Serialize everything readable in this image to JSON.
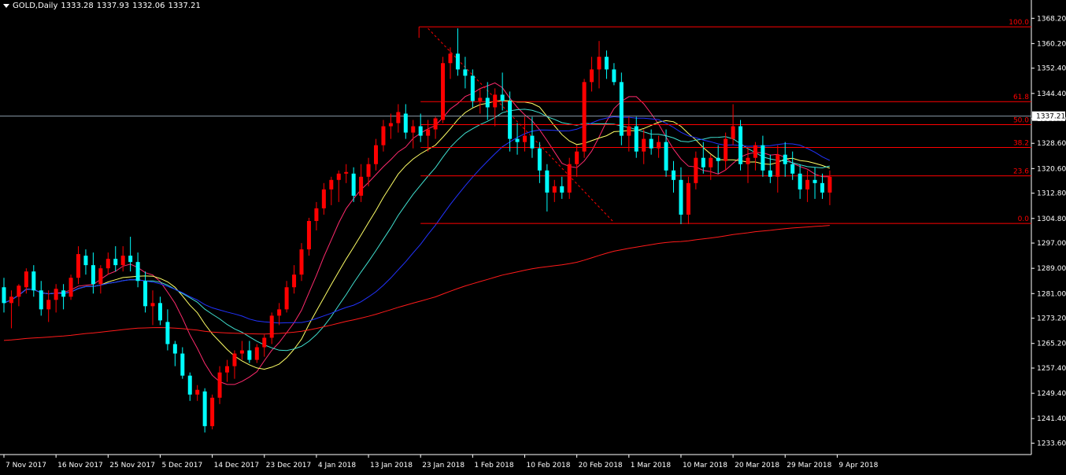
{
  "header": {
    "symbol": "GOLD,Daily",
    "open": "1333.28",
    "high": "1337.93",
    "low": "1332.06",
    "close": "1337.21"
  },
  "current_price_label": "1337.21",
  "colors": {
    "background": "#000000",
    "bull": "#ff0000",
    "bear": "#00ffff",
    "fib": "#ff0000",
    "ma_fast": "#ff2a6d",
    "ma_yellow": "#ffff66",
    "ma_cyan": "#40e0d0",
    "ma_blue": "#2233ff",
    "ma_200": "#ff1a1a",
    "current_price_line": "#8a9aa8"
  },
  "chart_data": {
    "type": "candlestick",
    "title": "GOLD,Daily",
    "ylim": [
      1230.0,
      1374.0
    ],
    "y_ticks": [
      "1368.20",
      "1360.20",
      "1352.40",
      "1344.40",
      "1336.40",
      "1328.60",
      "1320.60",
      "1312.80",
      "1304.80",
      "1297.00",
      "1289.00",
      "1281.00",
      "1273.20",
      "1265.20",
      "1257.40",
      "1249.40",
      "1241.40",
      "1233.60"
    ],
    "x_labels": [
      {
        "i": 0,
        "text": "7 Nov 2017"
      },
      {
        "i": 7,
        "text": "16 Nov 2017"
      },
      {
        "i": 14,
        "text": "25 Nov 2017"
      },
      {
        "i": 21,
        "text": "5 Dec 2017"
      },
      {
        "i": 28,
        "text": "14 Dec 2017"
      },
      {
        "i": 35,
        "text": "23 Dec 2017"
      },
      {
        "i": 42,
        "text": "4 Jan 2018"
      },
      {
        "i": 49,
        "text": "13 Jan 2018"
      },
      {
        "i": 56,
        "text": "23 Jan 2018"
      },
      {
        "i": 63,
        "text": "1 Feb 2018"
      },
      {
        "i": 70,
        "text": "10 Feb 2018"
      },
      {
        "i": 77,
        "text": "20 Feb 2018"
      },
      {
        "i": 84,
        "text": "1 Mar 2018"
      },
      {
        "i": 91,
        "text": "10 Mar 2018"
      },
      {
        "i": 98,
        "text": "20 Mar 2018"
      },
      {
        "i": 105,
        "text": "29 Mar 2018"
      },
      {
        "i": 112,
        "text": "9 Apr 2018"
      }
    ],
    "candles": [
      [
        1283.0,
        1286.0,
        1275.0,
        1278.0
      ],
      [
        1278.0,
        1282.0,
        1270.0,
        1280.0
      ],
      [
        1280.0,
        1284.0,
        1277.0,
        1283.5
      ],
      [
        1283.0,
        1289.0,
        1281.0,
        1288.0
      ],
      [
        1288.0,
        1290.0,
        1280.0,
        1282.0
      ],
      [
        1282.0,
        1285.0,
        1274.0,
        1276.0
      ],
      [
        1276.0,
        1282.0,
        1272.0,
        1279.0
      ],
      [
        1279.0,
        1284.0,
        1275.0,
        1282.5
      ],
      [
        1282.0,
        1284.0,
        1276.0,
        1280.0
      ],
      [
        1280.0,
        1287.0,
        1279.0,
        1286.0
      ],
      [
        1286.0,
        1296.0,
        1284.0,
        1293.5
      ],
      [
        1293.0,
        1295.0,
        1287.0,
        1290.0
      ],
      [
        1290.0,
        1294.0,
        1281.0,
        1284.0
      ],
      [
        1284.0,
        1290.0,
        1281.0,
        1289.0
      ],
      [
        1289.0,
        1294.0,
        1287.0,
        1292.0
      ],
      [
        1292.0,
        1296.0,
        1288.0,
        1290.0
      ],
      [
        1290.0,
        1296.0,
        1288.0,
        1293.0
      ],
      [
        1293.0,
        1299.0,
        1288.0,
        1291.0
      ],
      [
        1291.0,
        1294.0,
        1283.0,
        1285.0
      ],
      [
        1285.0,
        1288.0,
        1275.0,
        1277.0
      ],
      [
        1277.0,
        1282.0,
        1271.0,
        1278.0
      ],
      [
        1278.0,
        1280.0,
        1271.0,
        1272.5
      ],
      [
        1272.0,
        1276.0,
        1263.0,
        1265.0
      ],
      [
        1265.0,
        1266.0,
        1258.0,
        1262.0
      ],
      [
        1262.0,
        1264.0,
        1254.0,
        1255.0
      ],
      [
        1255.0,
        1256.0,
        1247.0,
        1249.0
      ],
      [
        1249.0,
        1252.0,
        1247.0,
        1250.5
      ],
      [
        1250.0,
        1251.0,
        1237.0,
        1239.0
      ],
      [
        1239.0,
        1249.0,
        1238.0,
        1248.0
      ],
      [
        1248.0,
        1258.0,
        1246.0,
        1256.0
      ],
      [
        1256.0,
        1260.0,
        1253.0,
        1258.0
      ],
      [
        1258.0,
        1263.0,
        1254.0,
        1262.0
      ],
      [
        1262.0,
        1266.0,
        1260.0,
        1263.0
      ],
      [
        1263.0,
        1266.0,
        1259.0,
        1260.0
      ],
      [
        1260.0,
        1265.0,
        1259.0,
        1264.0
      ],
      [
        1264.0,
        1268.0,
        1261.0,
        1267.0
      ],
      [
        1267.0,
        1275.0,
        1265.0,
        1274.0
      ],
      [
        1274.0,
        1278.0,
        1271.0,
        1276.0
      ],
      [
        1276.0,
        1285.0,
        1275.0,
        1283.0
      ],
      [
        1283.0,
        1290.0,
        1281.0,
        1287.0
      ],
      [
        1287.0,
        1297.0,
        1285.0,
        1295.0
      ],
      [
        1295.0,
        1305.0,
        1293.0,
        1304.0
      ],
      [
        1304.0,
        1310.0,
        1301.0,
        1308.0
      ],
      [
        1308.0,
        1316.0,
        1306.0,
        1314.0
      ],
      [
        1314.0,
        1318.0,
        1309.0,
        1317.0
      ],
      [
        1317.0,
        1320.0,
        1310.0,
        1319.0
      ],
      [
        1319.0,
        1322.0,
        1316.0,
        1319.5
      ],
      [
        1319.0,
        1321.0,
        1310.0,
        1312.0
      ],
      [
        1312.0,
        1322.0,
        1310.0,
        1318.0
      ],
      [
        1318.0,
        1324.0,
        1315.0,
        1322.0
      ],
      [
        1322.0,
        1330.0,
        1320.0,
        1328.0
      ],
      [
        1328.0,
        1336.0,
        1326.0,
        1334.0
      ],
      [
        1334.0,
        1338.0,
        1330.0,
        1335.0
      ],
      [
        1335.0,
        1341.0,
        1332.0,
        1338.5
      ],
      [
        1338.0,
        1341.0,
        1330.0,
        1332.0
      ],
      [
        1332.0,
        1336.0,
        1327.0,
        1334.0
      ],
      [
        1334.0,
        1338.0,
        1329.0,
        1331.0
      ],
      [
        1331.0,
        1336.0,
        1326.0,
        1333.0
      ],
      [
        1333.0,
        1337.0,
        1330.0,
        1336.5
      ],
      [
        1336.0,
        1356.0,
        1335.0,
        1354.0
      ],
      [
        1354.0,
        1359.0,
        1349.0,
        1357.0
      ],
      [
        1357.0,
        1365.0,
        1350.0,
        1352.0
      ],
      [
        1352.0,
        1356.0,
        1346.0,
        1350.0
      ],
      [
        1350.0,
        1352.0,
        1340.0,
        1342.0
      ],
      [
        1342.0,
        1346.0,
        1338.0,
        1343.0
      ],
      [
        1343.0,
        1348.0,
        1336.0,
        1340.0
      ],
      [
        1340.0,
        1346.0,
        1334.0,
        1344.0
      ],
      [
        1344.0,
        1351.0,
        1339.0,
        1342.0
      ],
      [
        1342.0,
        1345.0,
        1326.0,
        1330.0
      ],
      [
        1330.0,
        1335.0,
        1325.0,
        1329.0
      ],
      [
        1329.0,
        1337.0,
        1326.0,
        1331.0
      ],
      [
        1331.0,
        1337.0,
        1324.0,
        1327.0
      ],
      [
        1327.0,
        1329.0,
        1316.0,
        1320.0
      ],
      [
        1320.0,
        1322.0,
        1307.0,
        1313.0
      ],
      [
        1313.0,
        1317.0,
        1310.0,
        1315.0
      ],
      [
        1315.0,
        1318.0,
        1311.0,
        1313.0
      ],
      [
        1313.0,
        1324.0,
        1311.0,
        1322.0
      ],
      [
        1322.0,
        1328.0,
        1318.0,
        1326.0
      ],
      [
        1326.0,
        1349.0,
        1324.0,
        1348.0
      ],
      [
        1348.0,
        1356.0,
        1345.0,
        1352.0
      ],
      [
        1352.0,
        1361.0,
        1346.0,
        1356.0
      ],
      [
        1356.0,
        1358.0,
        1349.0,
        1352.0
      ],
      [
        1352.0,
        1354.0,
        1347.0,
        1348.0
      ],
      [
        1348.0,
        1351.0,
        1328.0,
        1331.0
      ],
      [
        1331.0,
        1337.0,
        1326.0,
        1334.0
      ],
      [
        1334.0,
        1337.0,
        1324.0,
        1326.0
      ],
      [
        1326.0,
        1333.0,
        1322.0,
        1330.0
      ],
      [
        1330.0,
        1333.0,
        1325.0,
        1327.0
      ],
      [
        1327.0,
        1331.0,
        1324.0,
        1329.0
      ],
      [
        1329.0,
        1333.0,
        1318.0,
        1320.0
      ],
      [
        1320.0,
        1323.0,
        1313.0,
        1317.0
      ],
      [
        1317.0,
        1321.0,
        1303.0,
        1306.0
      ],
      [
        1306.0,
        1318.0,
        1303.0,
        1316.0
      ],
      [
        1316.0,
        1326.0,
        1314.0,
        1324.0
      ],
      [
        1324.0,
        1329.0,
        1319.0,
        1321.0
      ],
      [
        1321.0,
        1325.0,
        1317.0,
        1324.0
      ],
      [
        1324.0,
        1328.0,
        1319.0,
        1323.0
      ],
      [
        1323.0,
        1332.0,
        1320.0,
        1330.0
      ],
      [
        1330.0,
        1341.0,
        1328.0,
        1334.0
      ],
      [
        1334.0,
        1336.0,
        1320.0,
        1322.0
      ],
      [
        1322.0,
        1327.0,
        1316.0,
        1324.0
      ],
      [
        1324.0,
        1329.0,
        1320.0,
        1328.0
      ],
      [
        1328.0,
        1331.0,
        1318.0,
        1320.0
      ],
      [
        1320.0,
        1325.0,
        1316.0,
        1318.0
      ],
      [
        1318.0,
        1328.0,
        1313.0,
        1325.0
      ],
      [
        1325.0,
        1329.0,
        1318.0,
        1322.0
      ],
      [
        1322.0,
        1326.0,
        1317.0,
        1319.0
      ],
      [
        1319.0,
        1322.0,
        1311.0,
        1314.0
      ],
      [
        1314.0,
        1320.0,
        1310.0,
        1317.0
      ],
      [
        1317.0,
        1321.0,
        1311.0,
        1316.0
      ],
      [
        1316.0,
        1319.0,
        1311.0,
        1313.0
      ],
      [
        1313.0,
        1320.0,
        1309.0,
        1318.0
      ]
    ],
    "fib_levels": [
      {
        "label": "100.0",
        "value": 1365.5
      },
      {
        "label": "61.8",
        "value": 1341.8
      },
      {
        "label": "50.0",
        "value": 1334.5
      },
      {
        "label": "38.2",
        "value": 1327.3
      },
      {
        "label": "23.6",
        "value": 1318.3
      },
      {
        "label": "0.0",
        "value": 1303.2
      }
    ],
    "current_price": 1337.21
  }
}
